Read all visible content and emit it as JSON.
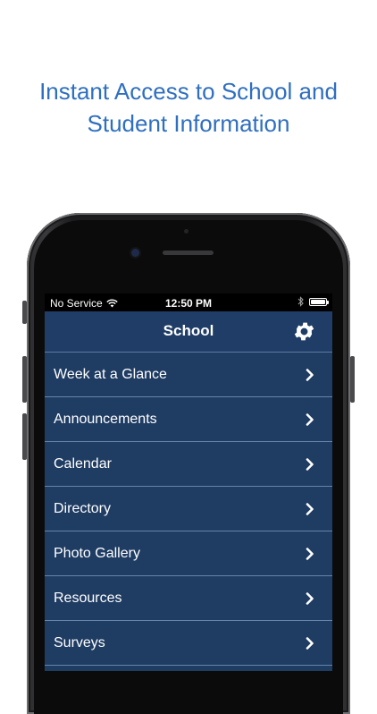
{
  "headline": {
    "line1": "Instant Access to School and",
    "line2": "Student Information"
  },
  "status_bar": {
    "carrier": "No Service",
    "time": "12:50 PM",
    "icons": [
      "wifi-icon",
      "bluetooth-icon",
      "battery-icon"
    ]
  },
  "nav": {
    "title": "School",
    "settings_icon": "gear-icon"
  },
  "menu": {
    "items": [
      {
        "label": "Week at a Glance"
      },
      {
        "label": "Announcements"
      },
      {
        "label": "Calendar"
      },
      {
        "label": "Directory"
      },
      {
        "label": "Photo Gallery"
      },
      {
        "label": "Resources"
      },
      {
        "label": "Surveys"
      }
    ]
  },
  "colors": {
    "headline": "#2f6fc0",
    "screen_background": "#1f3c63",
    "divider": "#6683aa"
  }
}
